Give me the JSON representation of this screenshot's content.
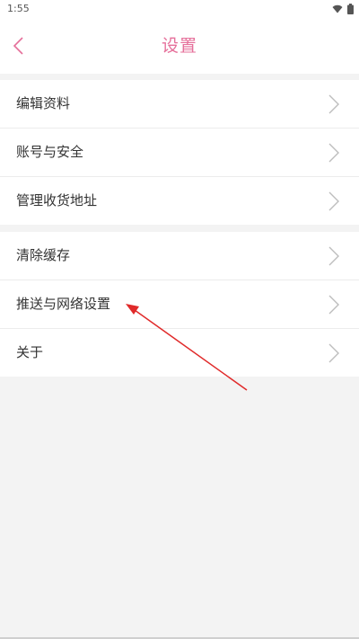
{
  "status_bar": {
    "time": "1:55"
  },
  "header": {
    "title": "设置"
  },
  "groups": [
    {
      "items": [
        {
          "label": "编辑资料"
        },
        {
          "label": "账号与安全"
        },
        {
          "label": "管理收货地址"
        }
      ]
    },
    {
      "items": [
        {
          "label": "清除缓存"
        },
        {
          "label": "推送与网络设置"
        },
        {
          "label": "关于"
        }
      ]
    }
  ],
  "icons": {
    "back": "chevron-left-icon",
    "row": "chevron-right-icon",
    "wifi": "wifi-icon",
    "battery": "battery-icon",
    "annotation": "arrow-icon"
  },
  "colors": {
    "accent": "#e56f9a",
    "annotation": "#e02a2a",
    "background": "#f3f3f3"
  }
}
